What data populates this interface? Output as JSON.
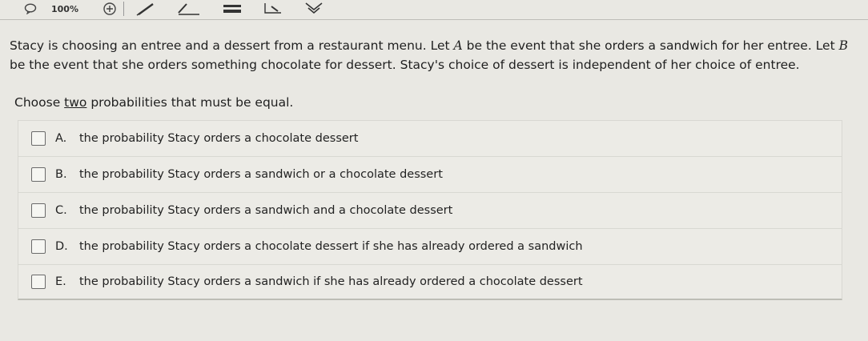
{
  "toolbar": {
    "zoom": "100%",
    "icons": [
      "speech-bubble-icon",
      "zoom-in-icon",
      "pen-icon",
      "highlighter-icon",
      "line-icon",
      "eraser-icon",
      "tag-icon",
      "clear-icon"
    ]
  },
  "question": {
    "stem_part1": "Stacy is choosing an entree and a dessert from a restaurant menu. Let ",
    "event_a": "A",
    "stem_part2": " be the event that she orders a sandwich for her entree. Let ",
    "event_b": "B",
    "stem_part3": " be the event that she orders something chocolate for dessert. Stacy's choice of dessert is independent of her choice of entree.",
    "instruction_pre": "Choose ",
    "instruction_emph": "two",
    "instruction_post": " probabilities that must be equal."
  },
  "options": [
    {
      "letter": "A.",
      "text": "the probability Stacy orders a chocolate dessert"
    },
    {
      "letter": "B.",
      "text": "the probability Stacy orders a sandwich or a chocolate dessert"
    },
    {
      "letter": "C.",
      "text": "the probability Stacy orders a sandwich and a chocolate dessert"
    },
    {
      "letter": "D.",
      "text": "the probability Stacy orders a chocolate dessert if she has already ordered a sandwich"
    },
    {
      "letter": "E.",
      "text": "the probability Stacy orders a sandwich if she has already ordered a chocolate dessert"
    }
  ]
}
